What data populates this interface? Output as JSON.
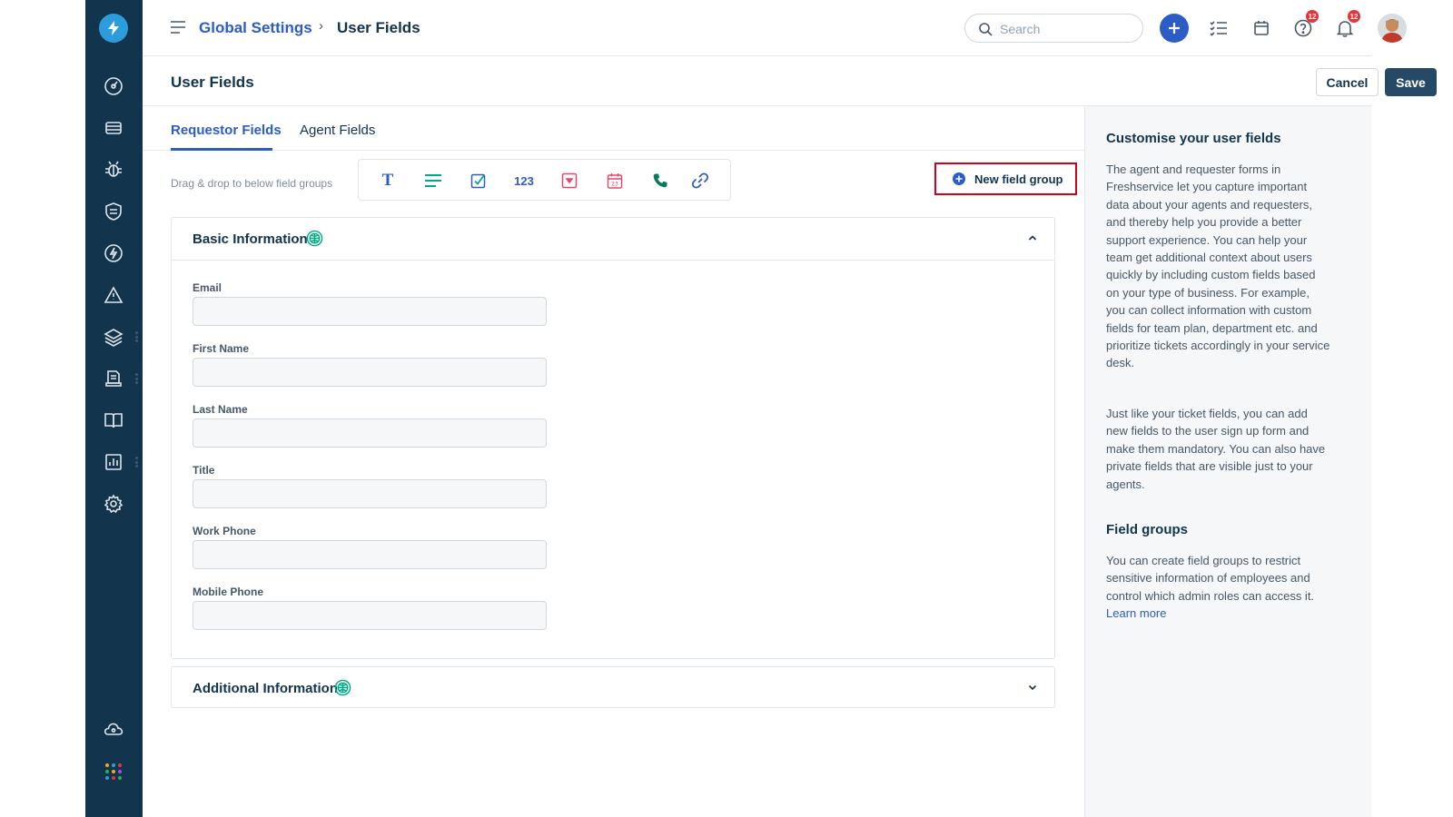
{
  "breadcrumb": {
    "parent": "Global Settings",
    "separator": "›",
    "current": "User Fields"
  },
  "search": {
    "placeholder": "Search"
  },
  "notifications": {
    "help_badge": "12",
    "bell_badge": "12"
  },
  "header": {
    "title": "User Fields",
    "cancel_label": "Cancel",
    "save_label": "Save"
  },
  "tabs": [
    {
      "label": "Requestor Fields",
      "active": true
    },
    {
      "label": "Agent Fields",
      "active": false
    }
  ],
  "toolbar": {
    "hint": "Drag & drop to below field groups",
    "items": [
      {
        "icon": "text-field-icon",
        "glyph": "T"
      },
      {
        "icon": "paragraph-field-icon"
      },
      {
        "icon": "checkbox-field-icon"
      },
      {
        "icon": "number-field-icon",
        "glyph": "123"
      },
      {
        "icon": "dropdown-field-icon"
      },
      {
        "icon": "date-field-icon"
      },
      {
        "icon": "phone-field-icon"
      },
      {
        "icon": "url-field-icon"
      }
    ],
    "new_group_label": "New field group"
  },
  "groups": [
    {
      "title": "Basic Information",
      "expanded": true,
      "fields": [
        {
          "label": "Email",
          "value": ""
        },
        {
          "label": "First Name",
          "value": ""
        },
        {
          "label": "Last Name",
          "value": ""
        },
        {
          "label": "Title",
          "value": ""
        },
        {
          "label": "Work Phone",
          "value": ""
        },
        {
          "label": "Mobile Phone",
          "value": ""
        }
      ]
    },
    {
      "title": "Additional Information",
      "expanded": false
    }
  ],
  "help": {
    "heading1": "Customise your user fields",
    "para1": "The agent and requester forms in Freshservice let you capture important data about your agents and requesters, and thereby help you provide a better support experience. You can help your team get additional context about users quickly by including custom fields based on your type of business. For example, you can collect information with custom fields for team plan, department etc. and prioritize tickets accordingly in your service desk.",
    "para2": "Just like your ticket fields, you can add new fields to the user sign up form and make them mandatory. You can also have private fields that are visible just to your agents.",
    "heading2": "Field groups",
    "para3": "You can create field groups to restrict sensitive information of employees and control which admin roles can access it.",
    "learn_more": "Learn more"
  },
  "colors": {
    "sidebar": "#12344d",
    "accent": "#2c5cc5",
    "highlight_border": "#d0021b",
    "save_button": "#264966"
  }
}
